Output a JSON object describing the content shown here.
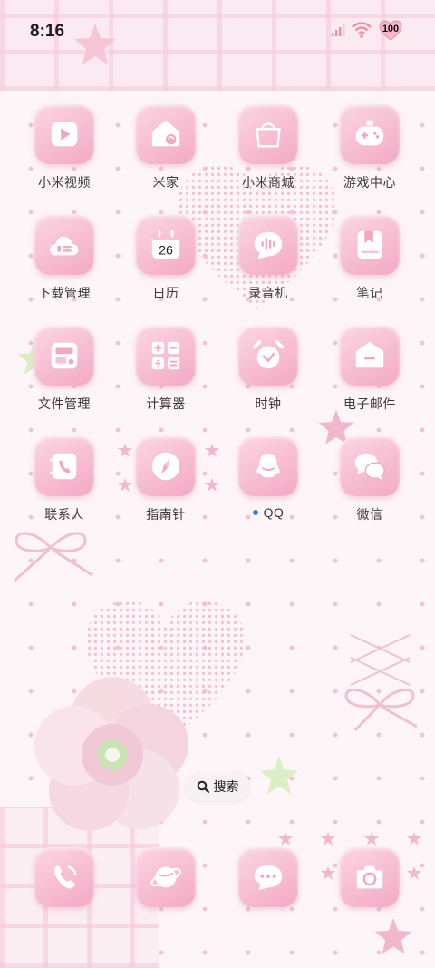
{
  "status_bar": {
    "time": "8:16",
    "battery": "100"
  },
  "apps": [
    {
      "label": "小米视频",
      "icon": "video-play-icon"
    },
    {
      "label": "米家",
      "icon": "smart-home-icon"
    },
    {
      "label": "小米商城",
      "icon": "shopping-bag-icon"
    },
    {
      "label": "游戏中心",
      "icon": "gamepad-icon"
    },
    {
      "label": "下载管理",
      "icon": "download-cloud-icon"
    },
    {
      "label": "日历",
      "icon": "calendar-icon",
      "badge": "26"
    },
    {
      "label": "录音机",
      "icon": "voice-recorder-icon"
    },
    {
      "label": "笔记",
      "icon": "notes-bookmark-icon"
    },
    {
      "label": "文件管理",
      "icon": "file-manager-icon"
    },
    {
      "label": "计算器",
      "icon": "calculator-icon"
    },
    {
      "label": "时钟",
      "icon": "alarm-clock-icon"
    },
    {
      "label": "电子邮件",
      "icon": "email-icon"
    },
    {
      "label": "联系人",
      "icon": "contacts-phone-icon"
    },
    {
      "label": "指南针",
      "icon": "compass-icon"
    },
    {
      "label": "QQ",
      "icon": "qq-penguin-icon",
      "new_indicator": true
    },
    {
      "label": "微信",
      "icon": "wechat-bubble-icon"
    }
  ],
  "search": {
    "label": "搜索",
    "icon": "search-icon"
  },
  "dock": [
    {
      "icon": "phone-icon"
    },
    {
      "icon": "browser-planet-icon"
    },
    {
      "icon": "messages-icon"
    },
    {
      "icon": "camera-icon"
    }
  ],
  "colors": {
    "tile_light": "#fbd6e3",
    "tile_dark": "#f3a9c3",
    "dot_blue": "#3b7bea"
  }
}
